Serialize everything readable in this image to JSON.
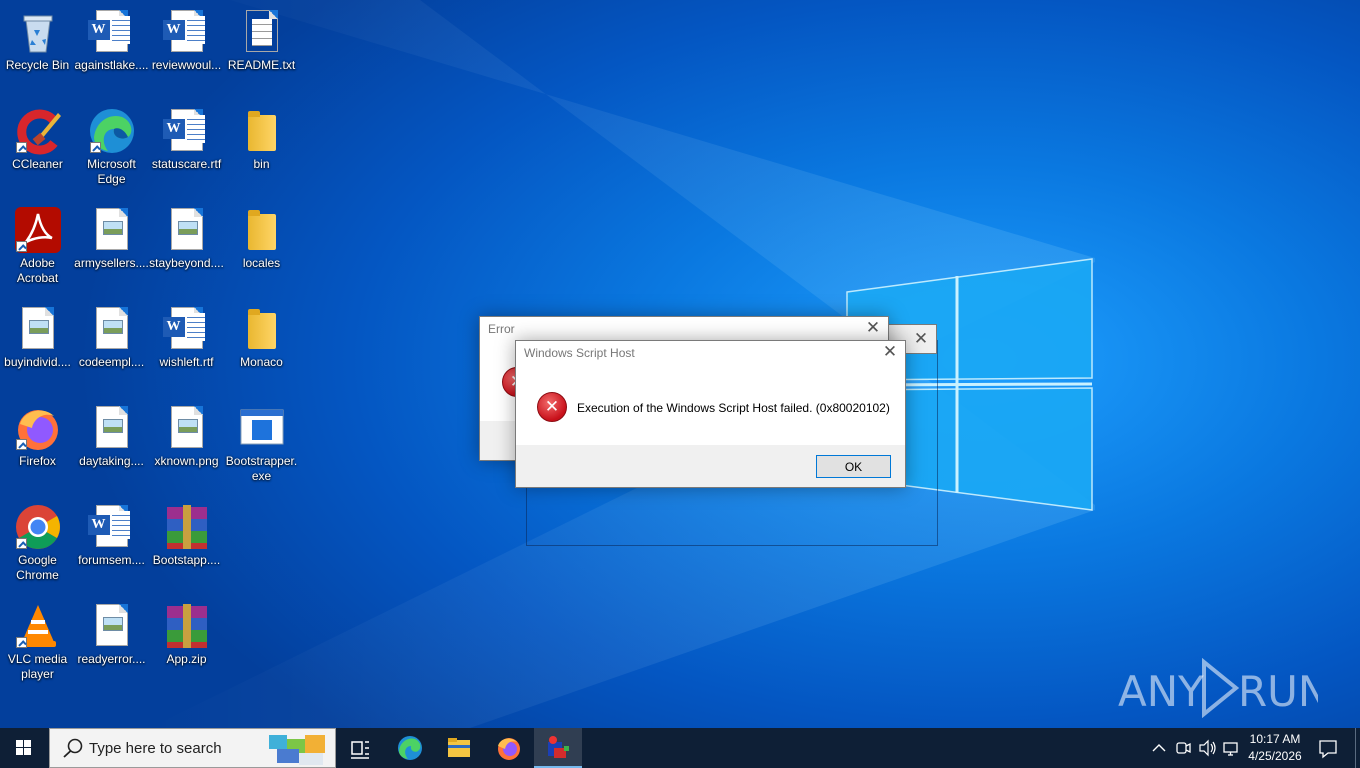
{
  "desktop": {
    "icons": [
      {
        "label": "Recycle Bin",
        "type": "recycle-bin"
      },
      {
        "label": "againstlake....",
        "type": "word"
      },
      {
        "label": "reviewwoul...",
        "type": "word"
      },
      {
        "label": "README.txt",
        "type": "text"
      },
      {
        "label": "CCleaner",
        "type": "ccleaner"
      },
      {
        "label": "Microsoft Edge",
        "type": "edge"
      },
      {
        "label": "statuscare.rtf",
        "type": "word"
      },
      {
        "label": "bin",
        "type": "folder"
      },
      {
        "label": "Adobe Acrobat",
        "type": "acrobat"
      },
      {
        "label": "armysellers....",
        "type": "image"
      },
      {
        "label": "staybeyond....",
        "type": "image"
      },
      {
        "label": "locales",
        "type": "folder"
      },
      {
        "label": "buyindivid....",
        "type": "image"
      },
      {
        "label": "codeempl....",
        "type": "image"
      },
      {
        "label": "wishleft.rtf",
        "type": "word"
      },
      {
        "label": "Monaco",
        "type": "folder"
      },
      {
        "label": "Firefox",
        "type": "firefox"
      },
      {
        "label": "daytaking....",
        "type": "image"
      },
      {
        "label": "xknown.png",
        "type": "image"
      },
      {
        "label": "Bootstrapper.exe",
        "type": "exe"
      },
      {
        "label": "Google Chrome",
        "type": "chrome"
      },
      {
        "label": "forumsem....",
        "type": "word"
      },
      {
        "label": "Bootstapp....",
        "type": "rar"
      },
      {
        "label": "VLC media player",
        "type": "vlc"
      },
      {
        "label": "readyerror....",
        "type": "image"
      },
      {
        "label": "App.zip",
        "type": "rar"
      }
    ]
  },
  "dialogs": {
    "error": {
      "title": "Error",
      "close": "✕"
    },
    "wsh": {
      "title": "Windows Script Host",
      "close": "✕",
      "message": "Execution of the Windows Script Host failed. (0x80020102)",
      "ok_label": "OK"
    }
  },
  "taskbar": {
    "search_placeholder": "Type here to search",
    "pinned": [
      "task-view-icon",
      "edge-icon",
      "file-explorer-icon",
      "firefox-icon",
      "running-app-icon"
    ],
    "tray": {
      "time": "10:17 AM",
      "date": "4/25/2026"
    }
  },
  "watermark": {
    "text": "ANY RUN"
  },
  "colors": {
    "desktop_blue": "#0a78e0",
    "taskbar": "#0e1f36",
    "error_red": "#c8101a",
    "dialog_bg": "#f0f0f0"
  }
}
